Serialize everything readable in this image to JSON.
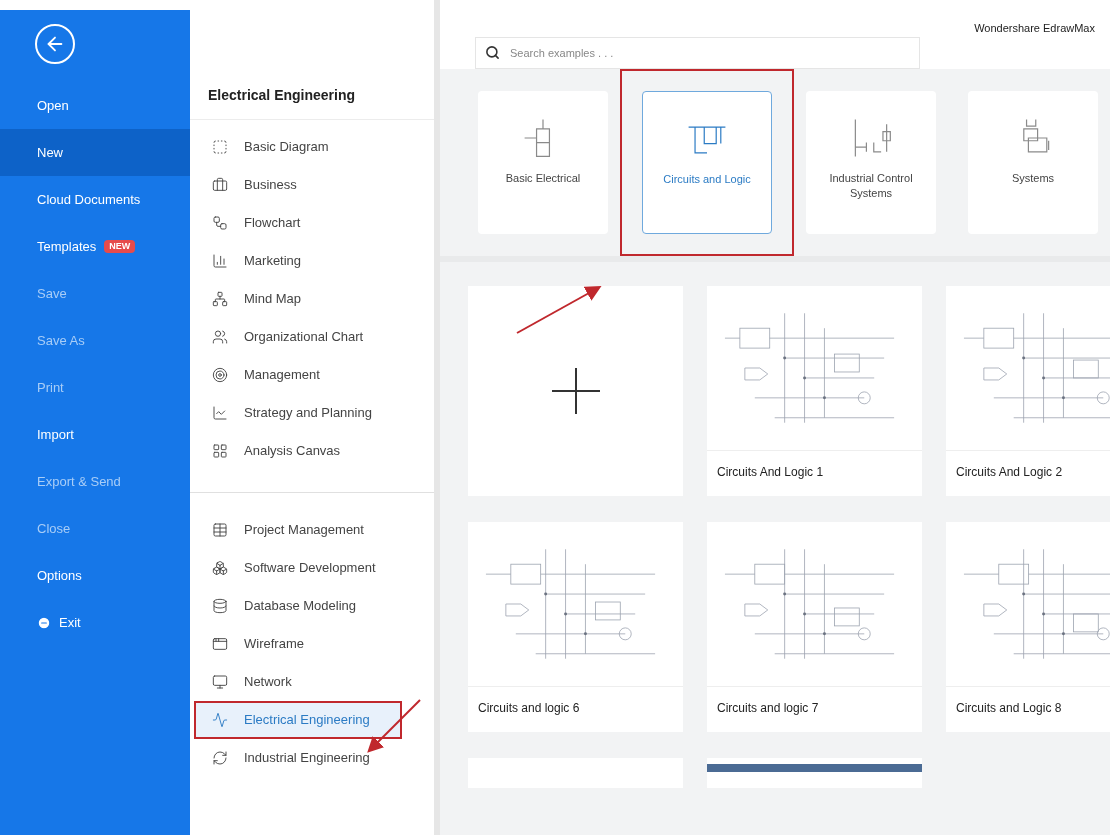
{
  "app_title": "Wondershare EdrawMax",
  "menu": [
    {
      "label": "Open",
      "selected": false,
      "disabled": false,
      "kind": "item"
    },
    {
      "label": "New",
      "selected": true,
      "disabled": false,
      "kind": "item"
    },
    {
      "label": "Cloud Documents",
      "selected": false,
      "disabled": false,
      "kind": "item"
    },
    {
      "label": "Templates",
      "selected": false,
      "disabled": false,
      "kind": "item",
      "badge": "NEW"
    },
    {
      "label": "Save",
      "selected": false,
      "disabled": true,
      "kind": "item"
    },
    {
      "label": "Save As",
      "selected": false,
      "disabled": true,
      "kind": "item"
    },
    {
      "label": "Print",
      "selected": false,
      "disabled": true,
      "kind": "item"
    },
    {
      "label": "Import",
      "selected": false,
      "disabled": false,
      "kind": "item"
    },
    {
      "label": "Export & Send",
      "selected": false,
      "disabled": true,
      "kind": "item"
    },
    {
      "label": "Close",
      "selected": false,
      "disabled": true,
      "kind": "item"
    },
    {
      "label": "Options",
      "selected": false,
      "disabled": false,
      "kind": "item"
    },
    {
      "label": "Exit",
      "selected": false,
      "disabled": false,
      "kind": "exit"
    }
  ],
  "category_panel": {
    "title": "Electrical Engineering",
    "groups": [
      [
        {
          "label": "Basic Diagram",
          "selected": false,
          "highlighted": false
        },
        {
          "label": "Business",
          "selected": false,
          "highlighted": false
        },
        {
          "label": "Flowchart",
          "selected": false,
          "highlighted": false
        },
        {
          "label": "Marketing",
          "selected": false,
          "highlighted": false
        },
        {
          "label": "Mind Map",
          "selected": false,
          "highlighted": false
        },
        {
          "label": "Organizational Chart",
          "selected": false,
          "highlighted": false
        },
        {
          "label": "Management",
          "selected": false,
          "highlighted": false
        },
        {
          "label": "Strategy and Planning",
          "selected": false,
          "highlighted": false
        },
        {
          "label": "Analysis Canvas",
          "selected": false,
          "highlighted": false
        }
      ],
      [
        {
          "label": "Project Management",
          "selected": false,
          "highlighted": false
        },
        {
          "label": "Software Development",
          "selected": false,
          "highlighted": false
        },
        {
          "label": "Database Modeling",
          "selected": false,
          "highlighted": false
        },
        {
          "label": "Wireframe",
          "selected": false,
          "highlighted": false
        },
        {
          "label": "Network",
          "selected": false,
          "highlighted": false
        },
        {
          "label": "Electrical Engineering",
          "selected": true,
          "highlighted": true
        },
        {
          "label": "Industrial Engineering",
          "selected": false,
          "highlighted": false
        }
      ]
    ]
  },
  "search": {
    "placeholder": "Search examples . . ."
  },
  "subcategories": [
    {
      "label": "Basic Electrical",
      "selected": false,
      "highlighted": false
    },
    {
      "label": "Circuits and Logic",
      "selected": true,
      "highlighted": true
    },
    {
      "label": "Industrial Control Systems",
      "selected": false,
      "highlighted": false
    },
    {
      "label": "Systems",
      "selected": false,
      "highlighted": false
    }
  ],
  "templates": [
    {
      "kind": "blank"
    },
    {
      "kind": "template",
      "title": "Circuits And Logic 1"
    },
    {
      "kind": "template",
      "title": "Circuits And Logic 2"
    },
    {
      "kind": "template",
      "title": "Circuits and logic 6"
    },
    {
      "kind": "template",
      "title": "Circuits and logic 7"
    },
    {
      "kind": "template",
      "title": "Circuits and Logic 8"
    },
    {
      "kind": "partial"
    },
    {
      "kind": "partial"
    }
  ]
}
